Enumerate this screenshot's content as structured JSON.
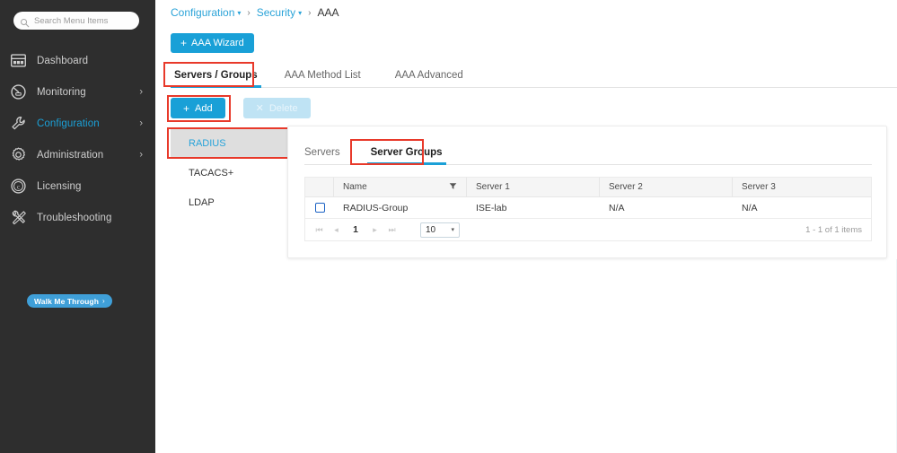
{
  "sidebar": {
    "search": {
      "placeholder": "Search Menu Items",
      "value": "",
      "icon": "search-icon"
    },
    "items": [
      {
        "label": "Dashboard",
        "icon": "dashboard-icon",
        "active": false,
        "chevron": ""
      },
      {
        "label": "Monitoring",
        "icon": "speedometer-icon",
        "active": false,
        "chevron": "›"
      },
      {
        "label": "Configuration",
        "icon": "wrench-icon",
        "active": true,
        "chevron": "›"
      },
      {
        "label": "Administration",
        "icon": "gear-icon",
        "active": false,
        "chevron": "›"
      },
      {
        "label": "Licensing",
        "icon": "copyright-icon",
        "active": false,
        "chevron": ""
      },
      {
        "label": "Troubleshooting",
        "icon": "tools-icon",
        "active": false,
        "chevron": ""
      }
    ],
    "walk_me_through": {
      "label": "Walk Me Through",
      "chevron": "›"
    },
    "background_color": "#2e2e2e",
    "active_color": "#1ba0d7"
  },
  "breadcrumb": {
    "items": [
      {
        "label": "Configuration",
        "caret": "▾",
        "link": true
      },
      {
        "label": "Security",
        "caret": "▾",
        "link": true
      },
      {
        "label": "AAA",
        "caret": "",
        "link": false
      }
    ],
    "separator": "›"
  },
  "wizard_button": {
    "label": "AAA Wizard",
    "plus": "+",
    "color": "#19a0d7"
  },
  "tabs": {
    "items": [
      {
        "label": "Servers / Groups",
        "active": true
      },
      {
        "label": "AAA Method List",
        "active": false
      },
      {
        "label": "AAA Advanced",
        "active": false
      }
    ]
  },
  "actions": {
    "add": {
      "label": "Add",
      "plus": "+",
      "enabled": true
    },
    "delete": {
      "label": "Delete",
      "x": "✕",
      "enabled": false
    }
  },
  "protocols": {
    "items": [
      {
        "label": "RADIUS",
        "active": true
      },
      {
        "label": "TACACS+",
        "active": false
      },
      {
        "label": "LDAP",
        "active": false
      }
    ]
  },
  "card": {
    "inner_tabs": [
      {
        "label": "Servers",
        "active": false
      },
      {
        "label": "Server Groups",
        "active": true
      }
    ],
    "table": {
      "columns": [
        "",
        "Name",
        "Server 1",
        "Server 2",
        "Server 3"
      ],
      "filter_icon": "filter-icon",
      "rows": [
        {
          "checked": false,
          "name": "RADIUS-Group",
          "server1": "ISE-lab",
          "server2": "N/A",
          "server3": "N/A"
        }
      ],
      "pagination": {
        "first": "⏮",
        "prev": "◂",
        "page": "1",
        "next": "▸",
        "last": "⏭",
        "page_size": "10",
        "caret": "▾",
        "info": "1 - 1 of 1 items"
      }
    }
  },
  "highlights": {
    "color": "#e8392a",
    "boxes": [
      "tab-servers-groups",
      "add-button",
      "radius-protocol",
      "server-groups-tab"
    ]
  }
}
